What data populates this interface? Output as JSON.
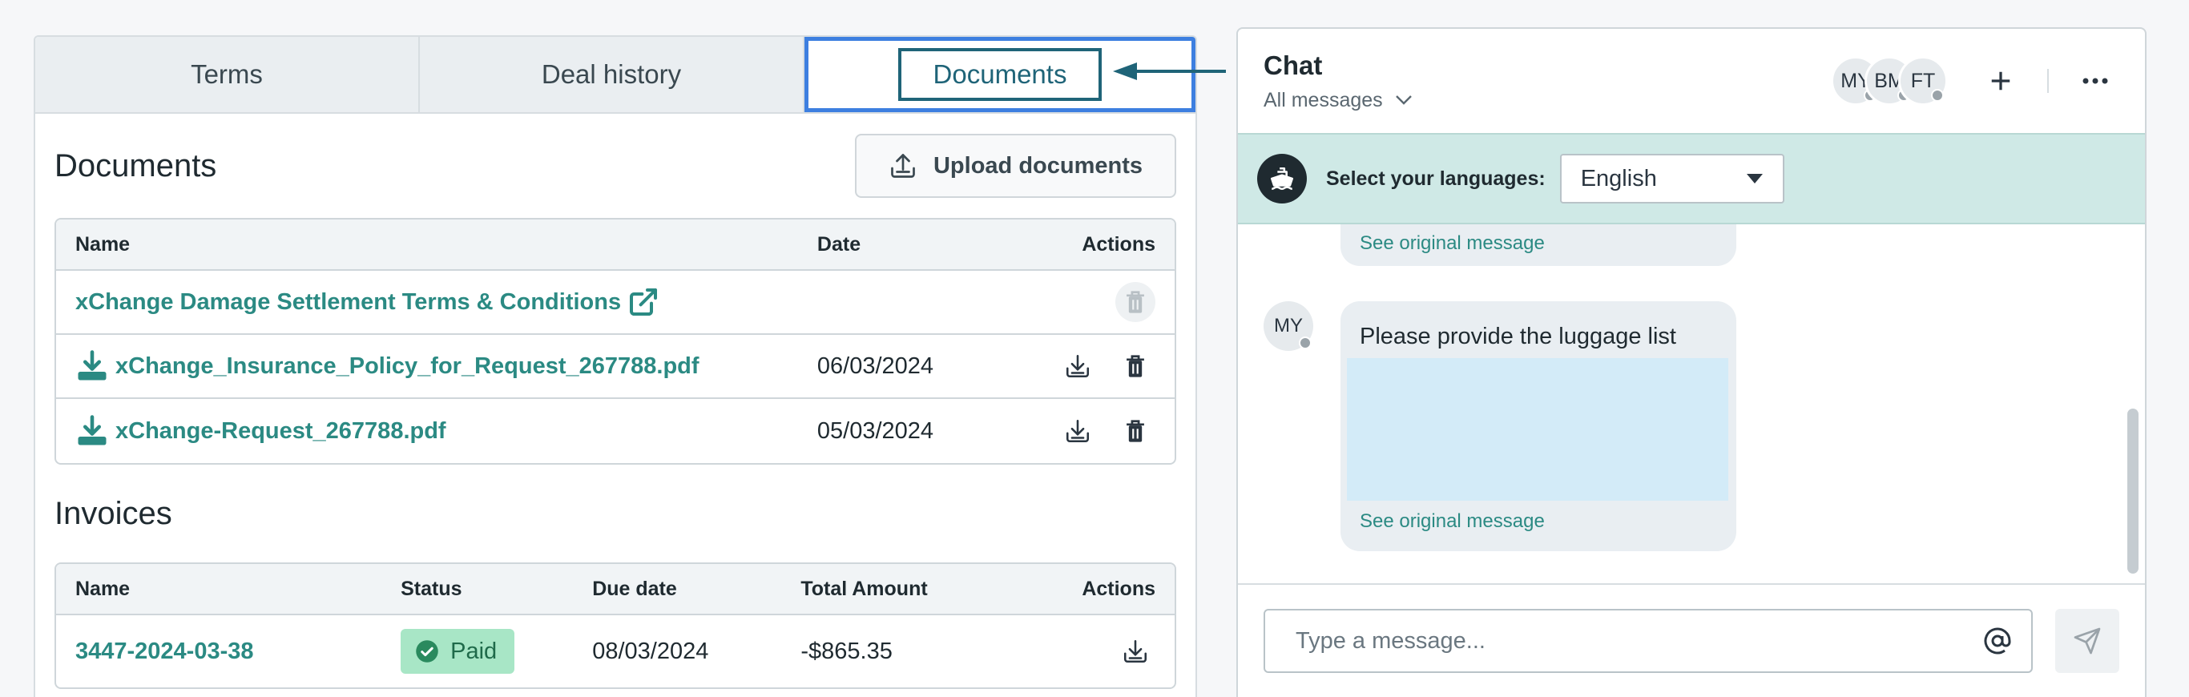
{
  "tabs": [
    {
      "label": "Terms"
    },
    {
      "label": "Deal history"
    },
    {
      "label": "Documents"
    }
  ],
  "documents": {
    "title": "Documents",
    "upload_label": "Upload documents",
    "columns": {
      "name": "Name",
      "date": "Date",
      "actions": "Actions"
    },
    "rows": [
      {
        "name": "xChange Damage Settlement Terms & Conditions",
        "date": ""
      },
      {
        "name": "xChange_Insurance_Policy_for_Request_267788.pdf",
        "date": "06/03/2024"
      },
      {
        "name": "xChange-Request_267788.pdf",
        "date": "05/03/2024"
      }
    ]
  },
  "invoices": {
    "title": "Invoices",
    "columns": {
      "name": "Name",
      "status": "Status",
      "due": "Due date",
      "total": "Total Amount",
      "actions": "Actions"
    },
    "rows": [
      {
        "name": "3447-2024-03-38",
        "status": "Paid",
        "due": "08/03/2024",
        "total": "-$865.35"
      }
    ]
  },
  "chat": {
    "title": "Chat",
    "filter": "All messages",
    "avatars": [
      "MY",
      "BM",
      "FT"
    ],
    "language_label": "Select your languages:",
    "language_value": "English",
    "messages": [
      {
        "see_original": "See original message"
      },
      {
        "avatar": "MY",
        "text": "Please provide the luggage list",
        "see_original": "See original message"
      }
    ],
    "input_placeholder": "Type a message..."
  },
  "colors": {
    "accent": "#2b8a83",
    "highlight": "#3d7fe0",
    "paid": "#a8e6c6"
  }
}
